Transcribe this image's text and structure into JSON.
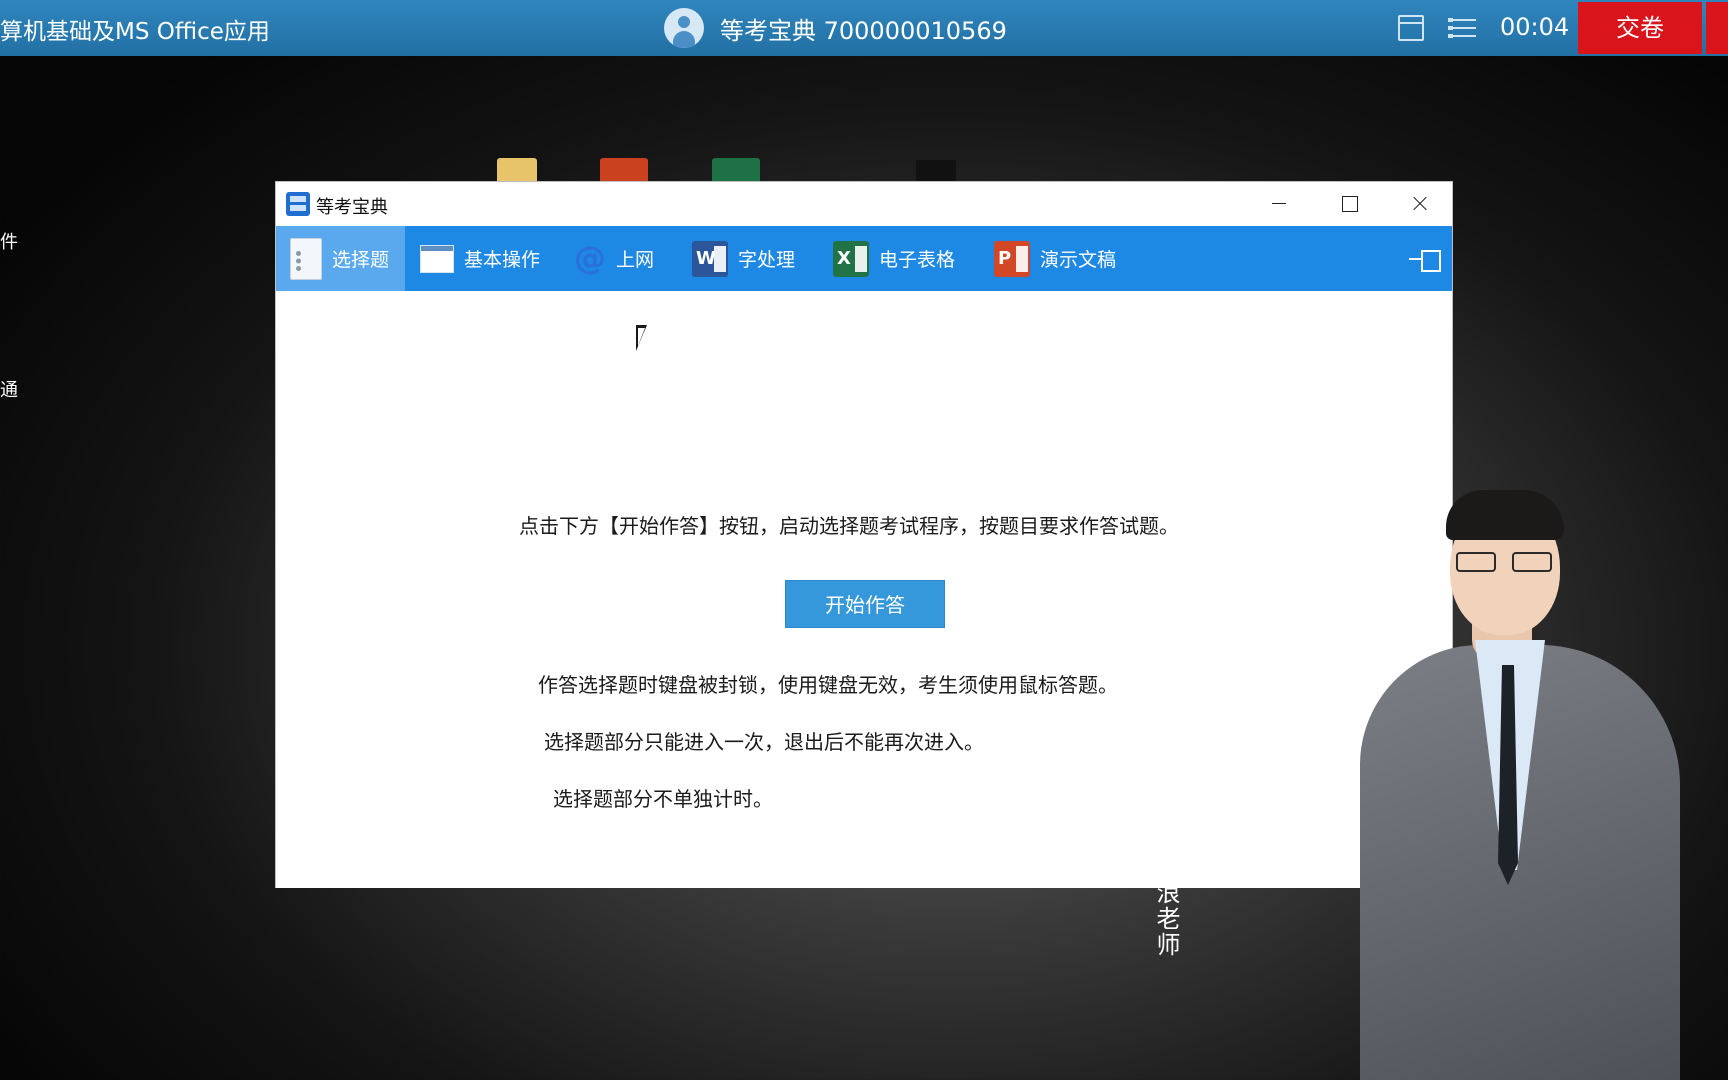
{
  "topbar": {
    "subject": "算机基础及MS Office应用",
    "user": "等考宝典 700000010569",
    "timer": "00:04",
    "submit_label": "交卷",
    "icons": [
      "user-avatar-icon",
      "window-icon",
      "list-icon"
    ],
    "colors": {
      "bar": "#2a7ab3",
      "submit": "#d9141b"
    }
  },
  "background": {
    "left_glyph_1": "件",
    "left_glyph_2": "通",
    "teacher_tag": "浪老师"
  },
  "window": {
    "title": "等考宝典",
    "tabs": [
      {
        "label": "选择题",
        "icon": "document-icon",
        "active": true
      },
      {
        "label": "基本操作",
        "icon": "window-icon",
        "active": false
      },
      {
        "label": "上网",
        "icon": "at-icon",
        "active": false
      },
      {
        "label": "字处理",
        "icon": "word-icon",
        "icon_letter": "W",
        "active": false
      },
      {
        "label": "电子表格",
        "icon": "excel-icon",
        "icon_letter": "X",
        "active": false
      },
      {
        "label": "演示文稿",
        "icon": "powerpoint-icon",
        "icon_letter": "P",
        "active": false
      }
    ],
    "tabbar_color": "#1e88e5"
  },
  "content": {
    "instruction": "点击下方【开始作答】按钮，启动选择题考试程序，按题目要求作答试题。",
    "start_button": "开始作答",
    "notes": [
      "作答选择题时键盘被封锁，使用键盘无效，考生须使用鼠标答题。",
      "选择题部分只能进入一次，退出后不能再次进入。",
      "选择题部分不单独计时。"
    ]
  }
}
